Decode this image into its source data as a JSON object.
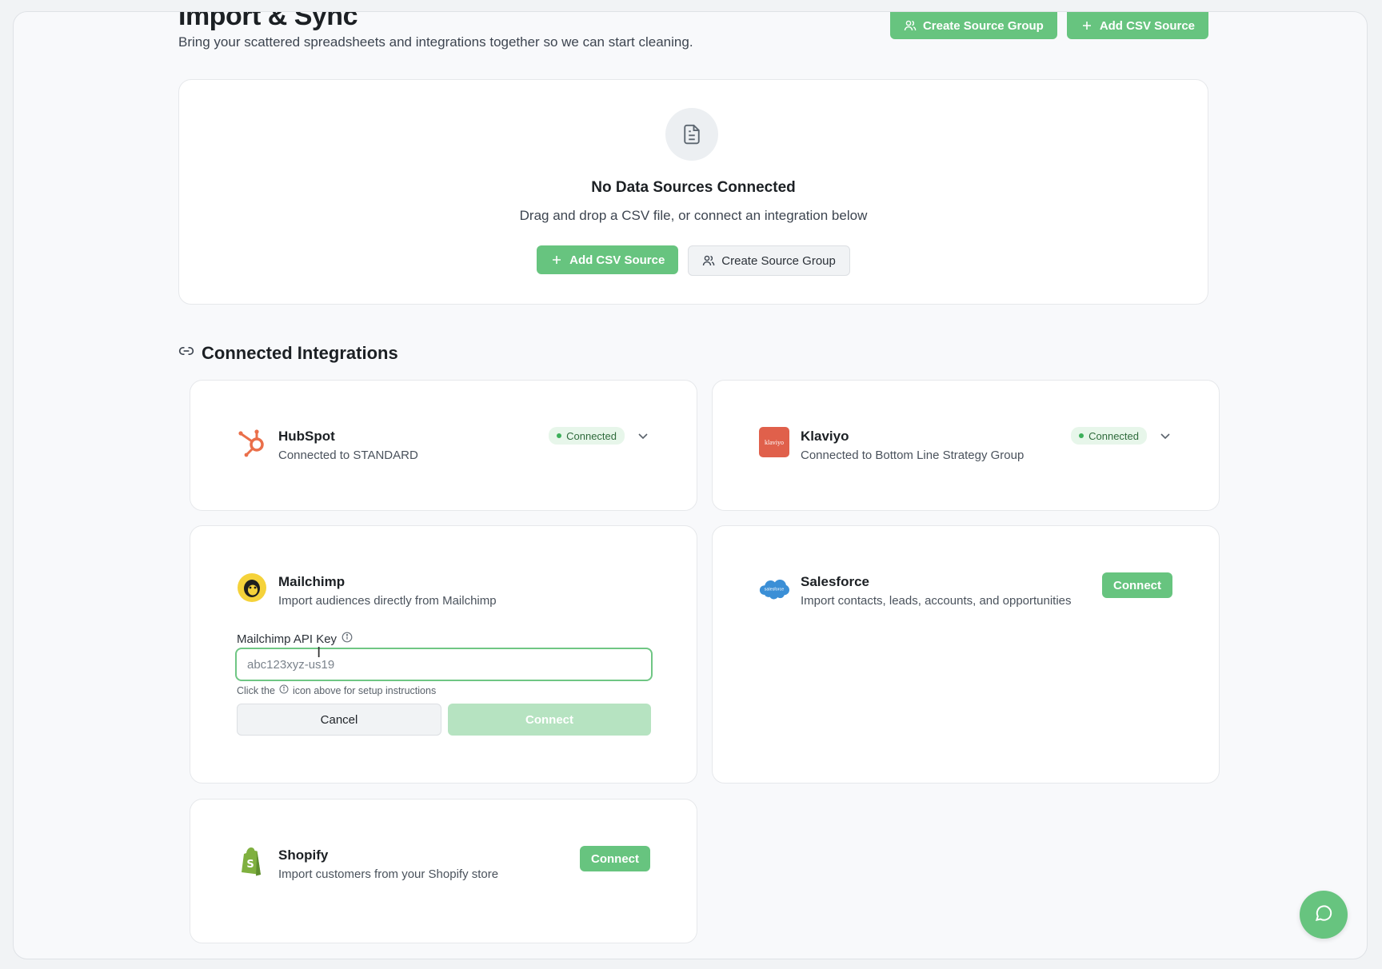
{
  "header": {
    "title": "Import & Sync",
    "subtitle": "Bring your scattered spreadsheets and integrations together so we can start cleaning.",
    "create_group_label": "Create Source Group",
    "add_csv_label": "Add CSV Source"
  },
  "empty_state": {
    "title": "No Data Sources Connected",
    "description": "Drag and drop a CSV file, or connect an integration below",
    "add_csv_label": "Add CSV Source",
    "create_group_label": "Create Source Group"
  },
  "integrations_section": {
    "title": "Connected Integrations"
  },
  "integrations": {
    "hubspot": {
      "name": "HubSpot",
      "description": "Connected to STANDARD",
      "status": "Connected"
    },
    "klaviyo": {
      "name": "Klaviyo",
      "description": "Connected to Bottom Line Strategy Group",
      "status": "Connected",
      "logo_text": "klaviyo"
    },
    "mailchimp": {
      "name": "Mailchimp",
      "description": "Import audiences directly from Mailchimp",
      "api_key_label": "Mailchimp API Key",
      "api_key_placeholder": "abc123xyz-us19",
      "hint_prefix": "Click the",
      "hint_suffix": "icon above for setup instructions",
      "cancel_label": "Cancel",
      "connect_label": "Connect"
    },
    "salesforce": {
      "name": "Salesforce",
      "description": "Import contacts, leads, accounts, and opportunities",
      "connect_label": "Connect",
      "logo_text": "salesforce"
    },
    "shopify": {
      "name": "Shopify",
      "description": "Import customers from your Shopify store",
      "connect_label": "Connect"
    }
  },
  "colors": {
    "accent": "#67c47f",
    "accent_disabled": "#b6e3c1",
    "hubspot": "#ea6f4a",
    "klaviyo": "#e0604b",
    "salesforce": "#3b8fd6",
    "shopify": "#7fb03f",
    "badge_bg": "#e7f6ea"
  }
}
